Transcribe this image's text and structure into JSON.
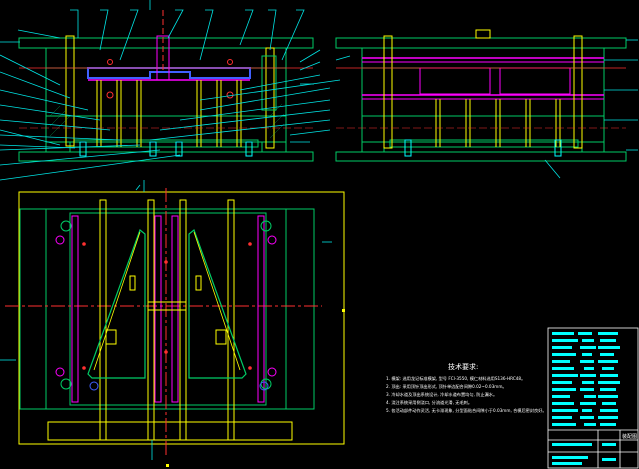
{
  "colors": {
    "background": "#000000",
    "outline": "#00cc66",
    "yellow": "#ffff00",
    "magenta": "#ff00ff",
    "cyan": "#00ffff",
    "red": "#ff3030",
    "white": "#ffffff",
    "blue": "#4060ff",
    "leader": "#00e5e5"
  },
  "notes": {
    "title": "技术要求:",
    "lines": [
      "1. 模架: 选用龙记标准模架, 型号 FCI-3550, 模仁材料选用S136-HRC48。",
      "2. 顶出: 采用顶针顶出形式, 顶针单边配合间隙0.02~0.03mm。",
      "3. 冷却水道及顶出系统设计, 冷却水道布置均匀, 防止漏水。",
      "4. 浇注系统采用侧浇口, 分流道光滑, 无毛刺。",
      "5. 各活动部件动作灵活, 无卡滞现象, 分型面贴合间隙小于0.03mm, 合模后密封良好。"
    ]
  },
  "titleblock": {
    "label": "装配图"
  }
}
